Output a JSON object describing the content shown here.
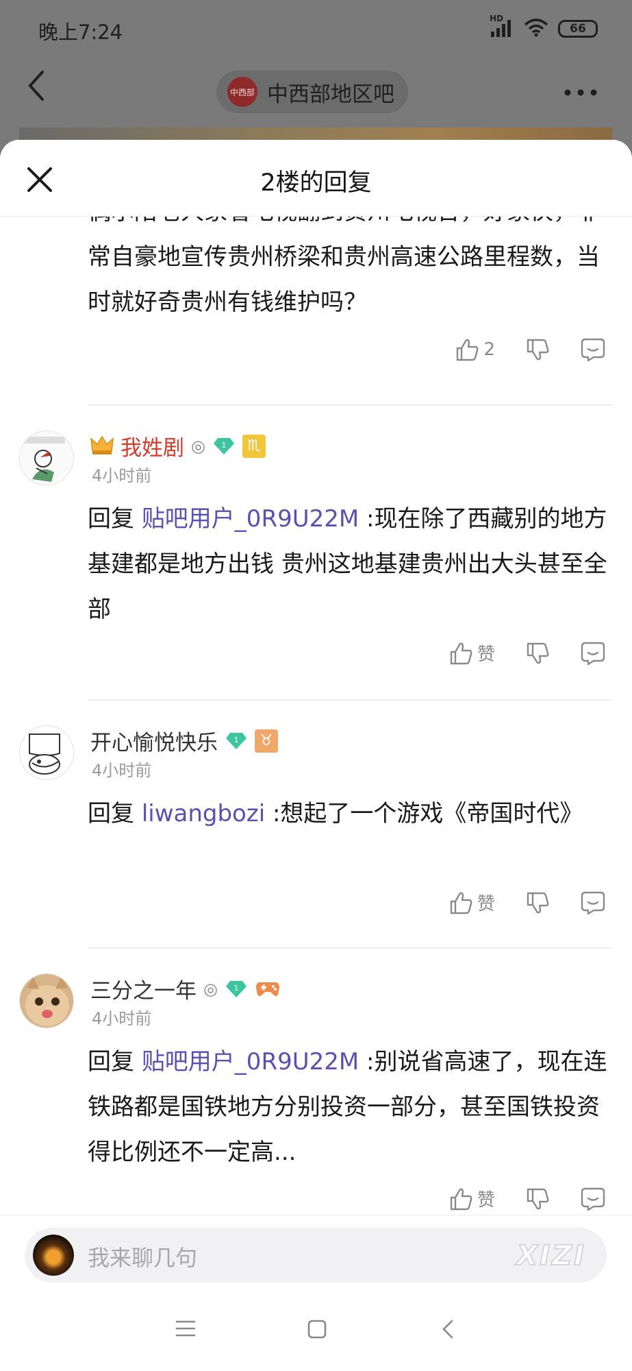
{
  "status_bar": {
    "time": "晚上7:24",
    "network": "HD",
    "battery": "66"
  },
  "background_nav": {
    "forum_name": "中西部地区吧",
    "forum_logo_text": "中西部"
  },
  "sheet": {
    "title": "2楼的回复"
  },
  "first_reply": {
    "text": "偶尔陪老人家看电视翻到贵州电视台，好家伙，非常自豪地宣传贵州桥梁和贵州高速公路里程数，当时就好奇贵州有钱维护吗？",
    "likes": "2"
  },
  "replies": [
    {
      "username": "我姓剧",
      "time": "4小时前",
      "reply_prefix": "回复",
      "reply_to": "贴吧用户_0R9U22M",
      "text": ":现在除了西藏别的地方基建都是地方出钱 贵州这地基建贵州出大头甚至全部",
      "like_label": "赞",
      "badge": "1",
      "zodiac": "♏"
    },
    {
      "username": "开心愉悦快乐",
      "time": "4小时前",
      "reply_prefix": "回复",
      "reply_to": "liwangbozi",
      "text": ":想起了一个游戏《帝国时代》",
      "like_label": "赞",
      "badge": "1",
      "zodiac": "♉"
    },
    {
      "username": "三分之一年",
      "time": "4小时前",
      "reply_prefix": "回复",
      "reply_to": "贴吧用户_0R9U22M",
      "text": ":别说省高速了，现在连铁路都是国铁地方分别投资一部分，甚至国铁投资得比例还不一定高...",
      "like_label": "赞",
      "badge": "1"
    }
  ],
  "input": {
    "placeholder": "我来聊几句",
    "watermark": "XIZI"
  },
  "colors": {
    "link": "#5b4fb0",
    "vip_name": "#d63b2e",
    "gem": "#3cc6a0"
  }
}
